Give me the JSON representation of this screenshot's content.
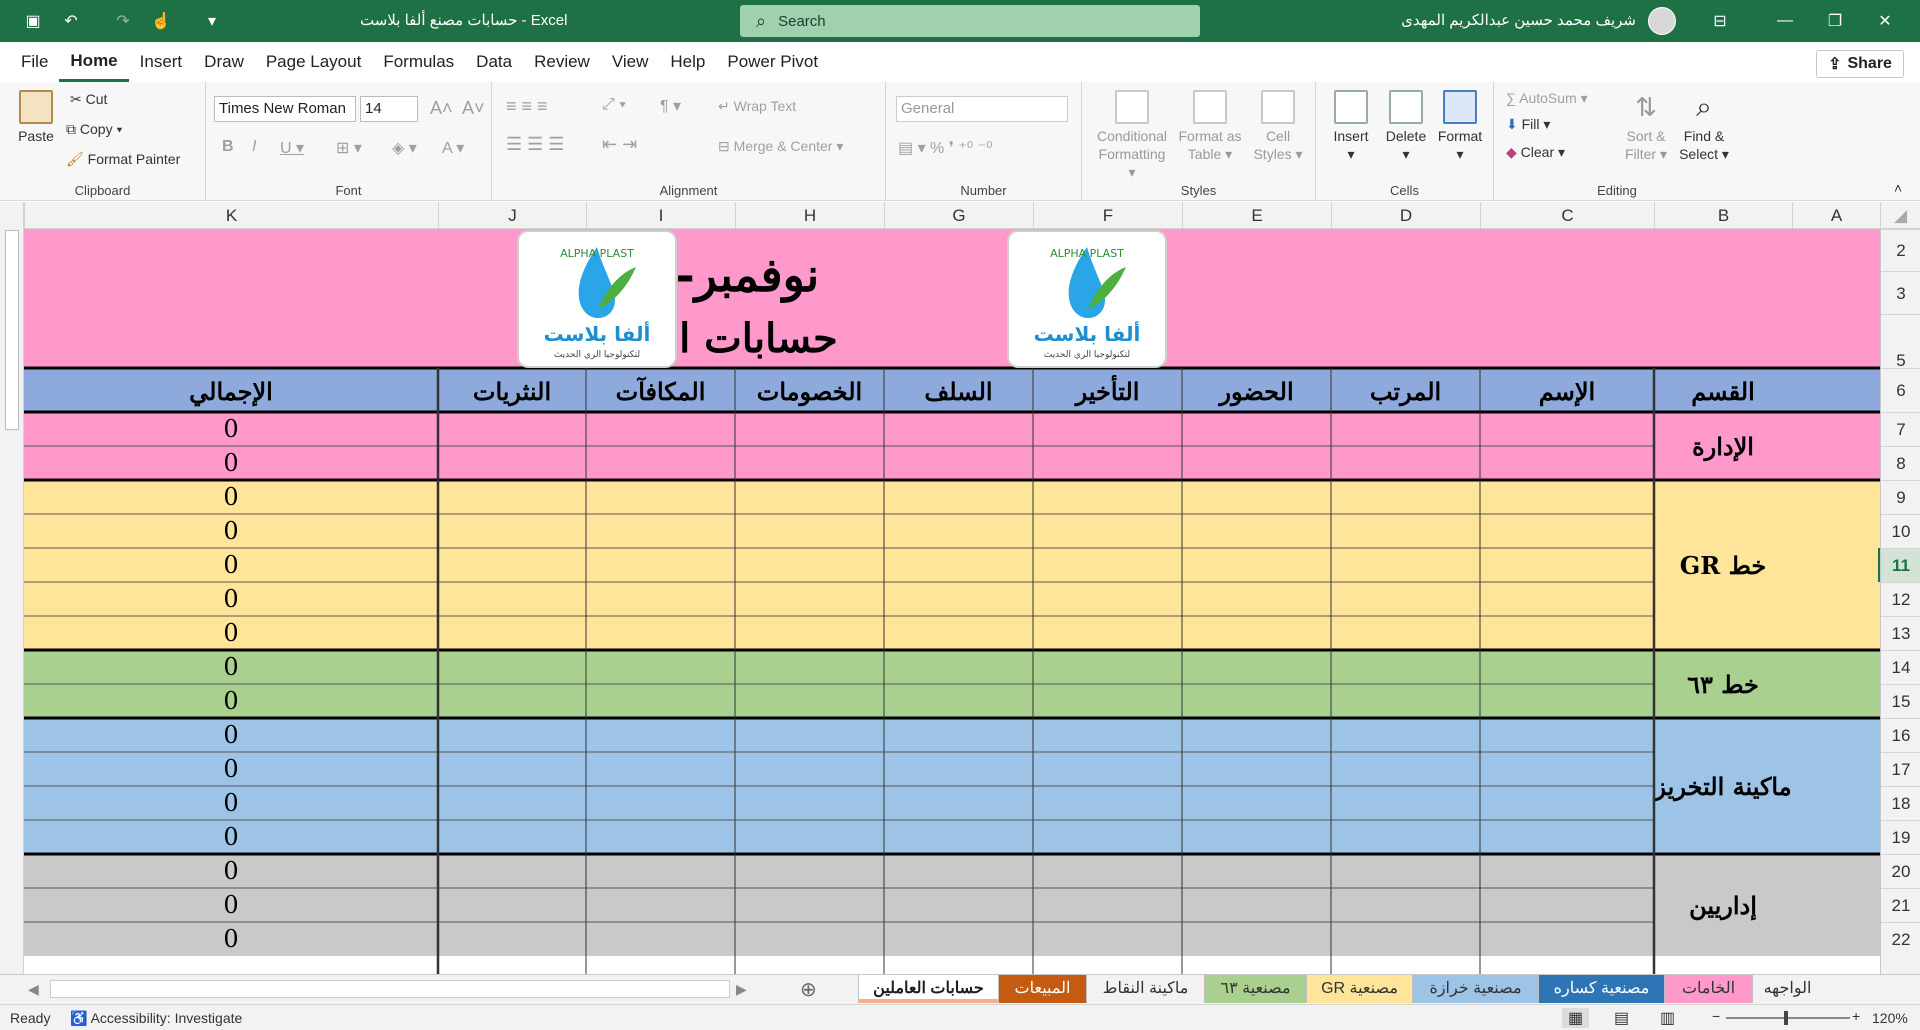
{
  "app": {
    "doc_title": "حسابات مصنع ألفا بلاست  -  Excel",
    "search_placeholder": "Search",
    "user_name": "شريف محمد حسين عبدالكريم المهدى"
  },
  "menu": {
    "tabs": [
      "File",
      "Home",
      "Insert",
      "Draw",
      "Page Layout",
      "Formulas",
      "Data",
      "Review",
      "View",
      "Help",
      "Power Pivot"
    ],
    "active": "Home",
    "share": "Share"
  },
  "ribbon": {
    "clipboard": {
      "label": "Clipboard",
      "paste": "Paste",
      "cut": "Cut",
      "copy": "Copy",
      "format_painter": "Format Painter"
    },
    "font": {
      "label": "Font",
      "name": "Times New Roman",
      "size": "14"
    },
    "alignment": {
      "label": "Alignment",
      "wrap": "Wrap Text",
      "merge": "Merge & Center"
    },
    "number": {
      "label": "Number",
      "format": "General"
    },
    "styles": {
      "label": "Styles",
      "conditional": [
        "Conditional",
        "Formatting"
      ],
      "format_table": [
        "Format as",
        "Table"
      ],
      "cell_styles": [
        "Cell",
        "Styles"
      ]
    },
    "cells": {
      "label": "Cells",
      "insert": "Insert",
      "delete": "Delete",
      "format": "Format"
    },
    "editing": {
      "label": "Editing",
      "autosum": "AutoSum",
      "fill": "Fill",
      "clear": "Clear",
      "sort": [
        "Sort &",
        "Filter"
      ],
      "find": [
        "Find &",
        "Select"
      ]
    }
  },
  "grid": {
    "columns": [
      "K",
      "J",
      "I",
      "H",
      "G",
      "F",
      "E",
      "D",
      "C",
      "B",
      "A"
    ],
    "rows": [
      "2",
      "3",
      "5",
      "6",
      "7",
      "8",
      "9",
      "10",
      "11",
      "12",
      "13",
      "14",
      "15",
      "16",
      "17",
      "18",
      "19",
      "20",
      "21",
      "22"
    ],
    "selected_row": "11"
  },
  "sheet": {
    "title_line1": "نوفمبر-٢٠٢٥",
    "title_line2": "حسابات العاملين",
    "logo_text": "ألفا بلاست",
    "logo_sub": "لتكنولوجيا الري الحديث",
    "logo_arc": "ALPHA PLAST",
    "headers": [
      "الإجمالي",
      "النثريات",
      "المكافآت",
      "الخصومات",
      "السلف",
      "التأخير",
      "الحضور",
      "المرتب",
      "الإسم",
      "القسم"
    ],
    "totals_value": "0",
    "sections": [
      {
        "name": "الإدارة",
        "color": "#ff99cc",
        "rows": 2
      },
      {
        "name": "خط GR",
        "color": "#ffe599",
        "rows": 5
      },
      {
        "name": "خط ٦٣",
        "color": "#a9d08e",
        "rows": 2
      },
      {
        "name": "ماكينة التخريز",
        "color": "#9dc3e6",
        "rows": 4
      },
      {
        "name": "إداريين",
        "color": "#c9c9c9",
        "rows": 3
      }
    ],
    "header_color": "#8ea9db",
    "title_color": "#ff99cc"
  },
  "sheet_tabs": [
    {
      "label": "حسابات العاملين",
      "color": "#f4b183",
      "active": true
    },
    {
      "label": "المبيعات",
      "color": "#c55a11",
      "active": false
    },
    {
      "label": "ماكينة النقاط",
      "color": "",
      "active": false
    },
    {
      "label": "مصنعية ٦٣",
      "color": "#a9d08e",
      "active": false
    },
    {
      "label": "مصنعية GR",
      "color": "#ffe599",
      "active": false
    },
    {
      "label": "مصنعية خرازة",
      "color": "#9dc3e6",
      "active": false
    },
    {
      "label": "مصنعية كساره",
      "color": "#2e75b6",
      "active": false
    },
    {
      "label": "الخامات",
      "color": "#ff99cc",
      "active": false
    },
    {
      "label": "الواجهه",
      "color": "",
      "active": false
    }
  ],
  "status": {
    "ready": "Ready",
    "accessibility": "Accessibility: Investigate",
    "zoom": "120%"
  }
}
